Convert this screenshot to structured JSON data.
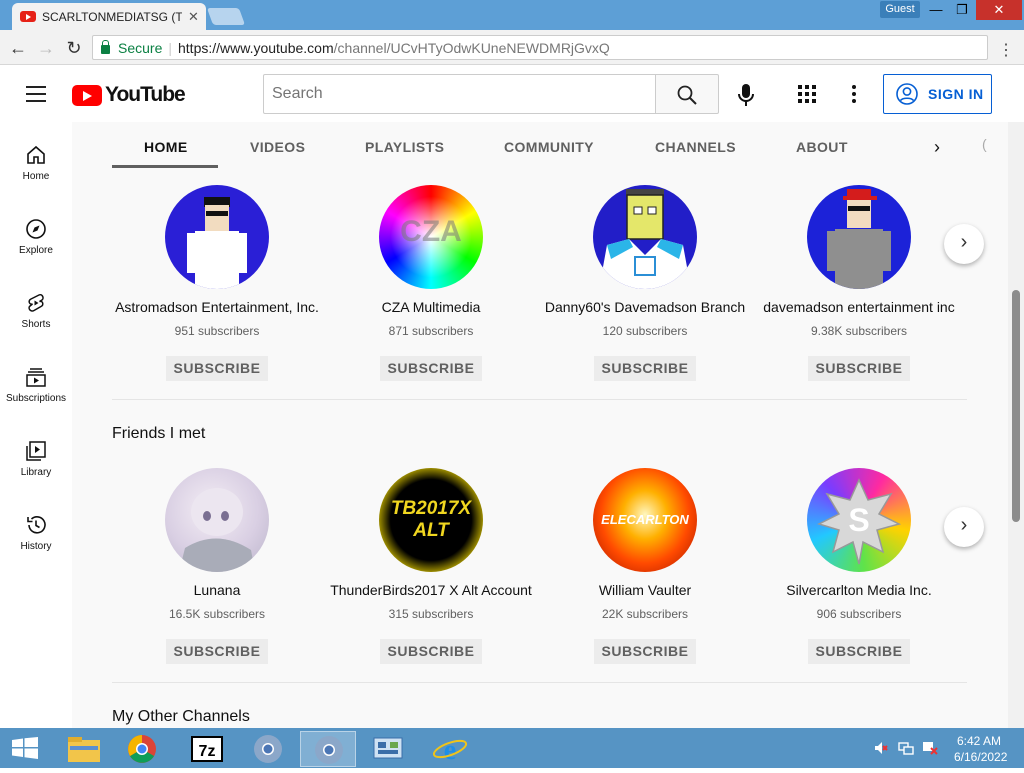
{
  "browser": {
    "tab_title": "SCARLTONMEDIATSG (T",
    "tab_close": "✕",
    "profile_label": "Guest",
    "window_controls": {
      "minimize": "—",
      "maximize": "❐",
      "close": "✕"
    },
    "nav": {
      "back": "←",
      "forward": "→",
      "reload": "↻"
    },
    "secure_label": "Secure",
    "separator": "|",
    "url_domain": "https://www.youtube.com",
    "url_path": "/channel/UCvHTyOdwKUneNEWDMRjGvxQ",
    "menu_dots": "⋮"
  },
  "youtube": {
    "logo_text": "YouTube",
    "search_placeholder": "Search",
    "sign_in_label": "SIGN IN"
  },
  "sidebar": {
    "items": [
      {
        "label": "Home",
        "icon": "home-icon"
      },
      {
        "label": "Explore",
        "icon": "compass-icon"
      },
      {
        "label": "Shorts",
        "icon": "shorts-icon"
      },
      {
        "label": "Subscriptions",
        "icon": "subscriptions-icon"
      },
      {
        "label": "Library",
        "icon": "library-icon"
      },
      {
        "label": "History",
        "icon": "history-icon"
      }
    ]
  },
  "tabs": {
    "items": [
      "HOME",
      "VIDEOS",
      "PLAYLISTS",
      "COMMUNITY",
      "CHANNELS",
      "ABOUT"
    ],
    "overflow": "(",
    "next_arrow": "›"
  },
  "shelves": [
    {
      "title": "",
      "channels": [
        {
          "name": "Astromadson Entertainment, Inc.",
          "subs": "951 subscribers",
          "button": "SUBSCRIBE"
        },
        {
          "name": "CZA Multimedia",
          "subs": "871 subscribers",
          "button": "SUBSCRIBE",
          "avatar_text": "CZA"
        },
        {
          "name": "Danny60's Davemadson Branch",
          "subs": "120 subscribers",
          "button": "SUBSCRIBE"
        },
        {
          "name": "davemadson entertainment inc",
          "subs": "9.38K subscribers",
          "button": "SUBSCRIBE"
        }
      ],
      "next": "›"
    },
    {
      "title": "Friends I met",
      "channels": [
        {
          "name": "Lunana",
          "subs": "16.5K subscribers",
          "button": "SUBSCRIBE"
        },
        {
          "name": "ThunderBirds2017 X Alt Account",
          "subs": "315 subscribers",
          "button": "SUBSCRIBE",
          "avatar_text": "TB2017X ALT"
        },
        {
          "name": "William Vaulter",
          "subs": "22K subscribers",
          "button": "SUBSCRIBE",
          "avatar_text": "ELECARLTON"
        },
        {
          "name": "Silvercarlton Media Inc.",
          "subs": "906 subscribers",
          "button": "SUBSCRIBE",
          "avatar_text": "S"
        }
      ],
      "next": "›"
    },
    {
      "title": "My Other Channels",
      "channels": []
    }
  ],
  "taskbar": {
    "time": "6:42 AM",
    "date": "6/16/2022",
    "apps": [
      "windows-start",
      "file-explorer",
      "chrome",
      "7zip",
      "chrome",
      "chrome-active",
      "control-panel",
      "internet-explorer"
    ]
  },
  "colors": {
    "chrome_frame": "#5d9fd6",
    "youtube_red": "#ff0000",
    "link_blue": "#065fd4",
    "taskbar": "#5694c4"
  }
}
